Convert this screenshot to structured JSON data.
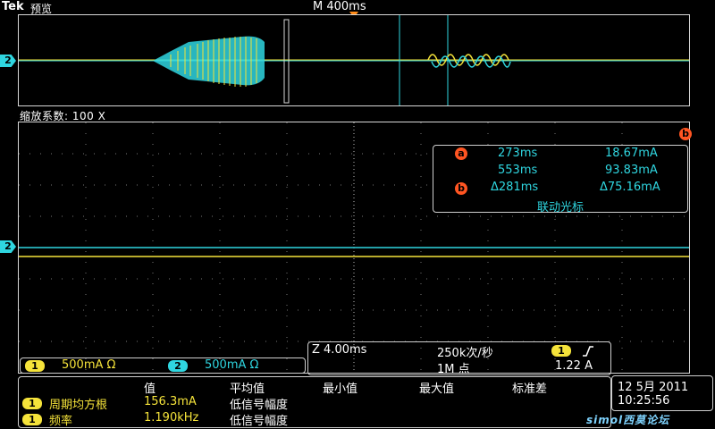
{
  "header": {
    "brand": "Tek",
    "mode": "预览",
    "timebase": "M 400ms"
  },
  "overview": {
    "channel_marker": "2"
  },
  "zoom": {
    "label": "缩放系数: 100 X"
  },
  "main": {
    "channel_marker": "2"
  },
  "cursors": {
    "corner_badge": "b",
    "a_badge": "a",
    "b_badge": "b",
    "a_time": "273ms",
    "a_value": "18.67mA",
    "b_time": "553ms",
    "b_value": "93.83mA",
    "delta_time": "Δ281ms",
    "delta_value": "Δ75.16mA",
    "link_label": "联动光标"
  },
  "channels": [
    {
      "id": "1",
      "scale": "500mA Ω",
      "color": "#f5e33a"
    },
    {
      "id": "2",
      "scale": "500mA Ω",
      "color": "#2fd6e0"
    }
  ],
  "acquisition": {
    "zoom_time": "Z 4.00ms",
    "sample_rate": "250k次/秒",
    "record_length": "1M 点",
    "trigger_channel": "1",
    "trigger_slope_icon": "rising-edge-icon",
    "trigger_level": "1.22 A"
  },
  "measurements": {
    "headers": [
      "值",
      "平均值",
      "最小值",
      "最大值",
      "标准差"
    ],
    "rows": [
      {
        "channel": "1",
        "name": "周期均方根",
        "value": "156.3mA",
        "note": "低信号幅度"
      },
      {
        "channel": "1",
        "name": "频率",
        "value": "1.190kHz",
        "note": "低信号幅度"
      }
    ]
  },
  "datetime": {
    "date": "12 5月  2011",
    "time": "10:25:56"
  },
  "watermark": "simol西莫论坛",
  "colors": {
    "ch1": "#f5e33a",
    "ch2": "#2fd6e0",
    "cursor_badge": "#ff5522",
    "trigger_marker": "#ff8c1a"
  }
}
